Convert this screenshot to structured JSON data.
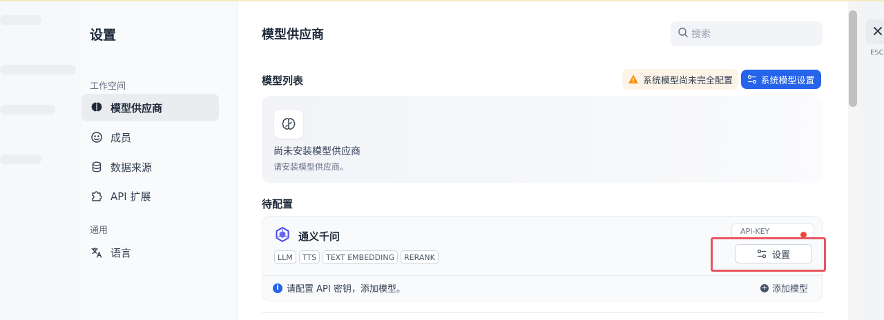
{
  "settings": {
    "title": "设置"
  },
  "nav": {
    "workspace_section": "工作空间",
    "general_section": "通用",
    "items": [
      {
        "label": "模型供应商",
        "icon": "brain-icon",
        "active": true
      },
      {
        "label": "成员",
        "icon": "members-icon",
        "active": false
      },
      {
        "label": "数据来源",
        "icon": "database-icon",
        "active": false
      },
      {
        "label": "API 扩展",
        "icon": "puzzle-icon",
        "active": false
      }
    ],
    "general_items": [
      {
        "label": "语言",
        "icon": "translate-icon"
      }
    ]
  },
  "main": {
    "title": "模型供应商",
    "search_placeholder": "搜索",
    "model_list_title": "模型列表",
    "warning_text": "系统模型尚未完全配置",
    "system_model_button": "系统模型设置",
    "empty": {
      "title": "尚未安装模型供应商",
      "subtitle": "请安装模型供应商。"
    },
    "pending_title": "待配置",
    "provider": {
      "name": "通义千问",
      "tags": [
        "LLM",
        "TTS",
        "TEXT EMBEDDING",
        "RERANK"
      ],
      "api_key_label": "API-KEY",
      "setup_button": "设置",
      "info_text": "请配置 API 密钥，添加模型。",
      "add_model": "添加模型"
    }
  },
  "close": {
    "esc_label": "ESC"
  },
  "colors": {
    "accent": "#2563eb",
    "warning_bg": "#fdf3e7",
    "warning_icon": "#f79009",
    "highlight": "#e8555f",
    "status_dot": "#f04438"
  }
}
